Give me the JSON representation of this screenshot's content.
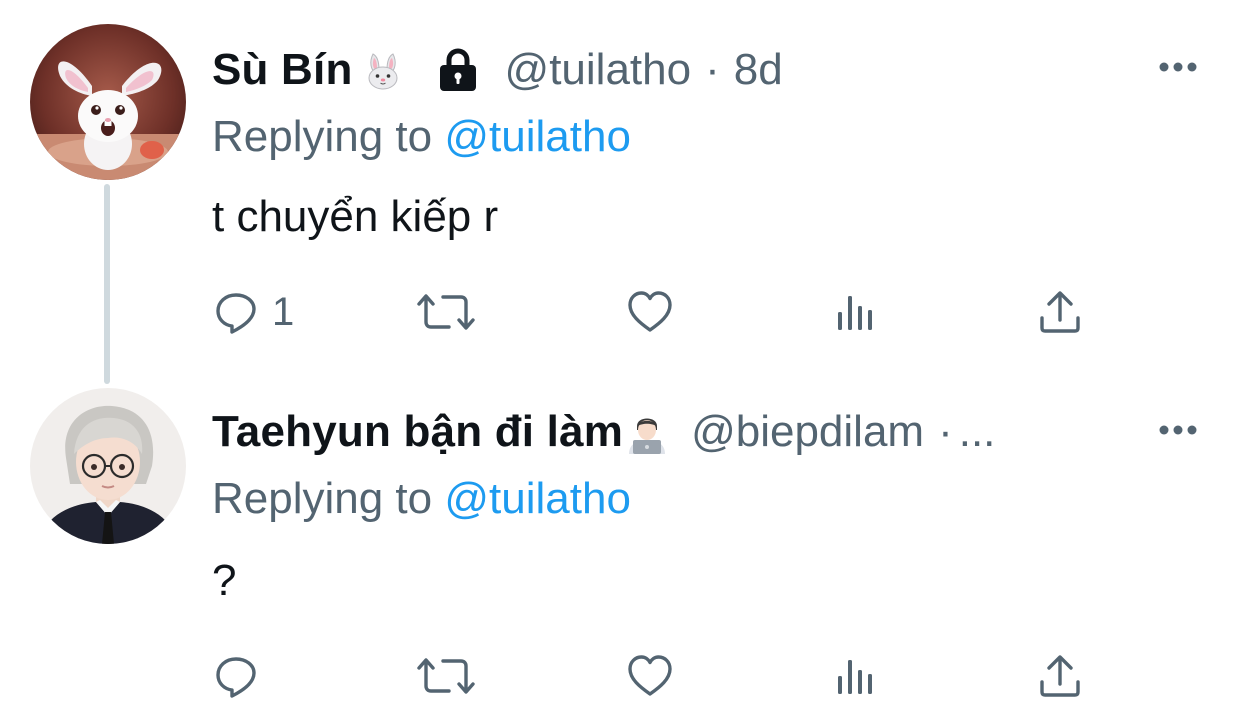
{
  "tweets": [
    {
      "display_name": "Sù Bín",
      "name_emoji": "rabbit-face-emoji",
      "protected": true,
      "handle": "@tuilatho",
      "dot": "·",
      "time": "8d",
      "replying_label": "Replying to ",
      "replying_to": "@tuilatho",
      "text": "t chuyển kiếp r",
      "reply_count": "1",
      "more_label": "•••"
    },
    {
      "display_name": "Taehyun bận đi làm",
      "name_emoji": "technologist-emoji",
      "protected": false,
      "handle": "@biepdilam",
      "dot": "·",
      "time_truncated": "...",
      "replying_label": "Replying to ",
      "replying_to": "@tuilatho",
      "text": "?",
      "reply_count": "",
      "more_label": "•••"
    }
  ],
  "icons": {
    "reply": "reply-icon",
    "retweet": "retweet-icon",
    "like": "heart-icon",
    "views": "views-icon",
    "share": "share-icon",
    "more": "more-icon",
    "lock": "lock-icon"
  },
  "colors": {
    "text_primary": "#0f1419",
    "text_secondary": "#536471",
    "accent": "#1d9bf0",
    "thread_line": "#cfd9de"
  }
}
